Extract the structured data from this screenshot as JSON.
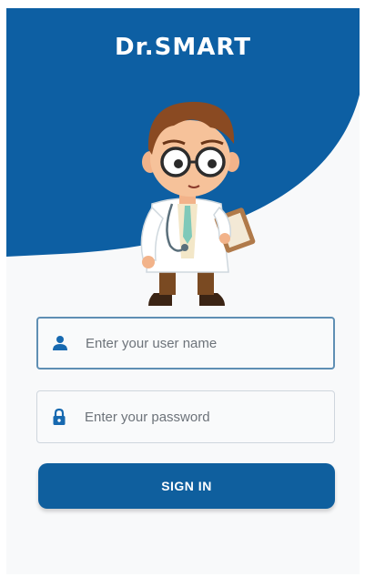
{
  "app": {
    "title": "Dr.SMART"
  },
  "login": {
    "username_placeholder": "Enter your user name",
    "password_placeholder": "Enter your password",
    "signin_label": "SIGN IN"
  },
  "icons": {
    "username": "person-icon",
    "password": "lock-icon"
  },
  "colors": {
    "brand": "#0d5fa3",
    "button": "#0f5f9e",
    "background": "#f8f9fa",
    "field_focus_border": "#5f8fb4"
  }
}
